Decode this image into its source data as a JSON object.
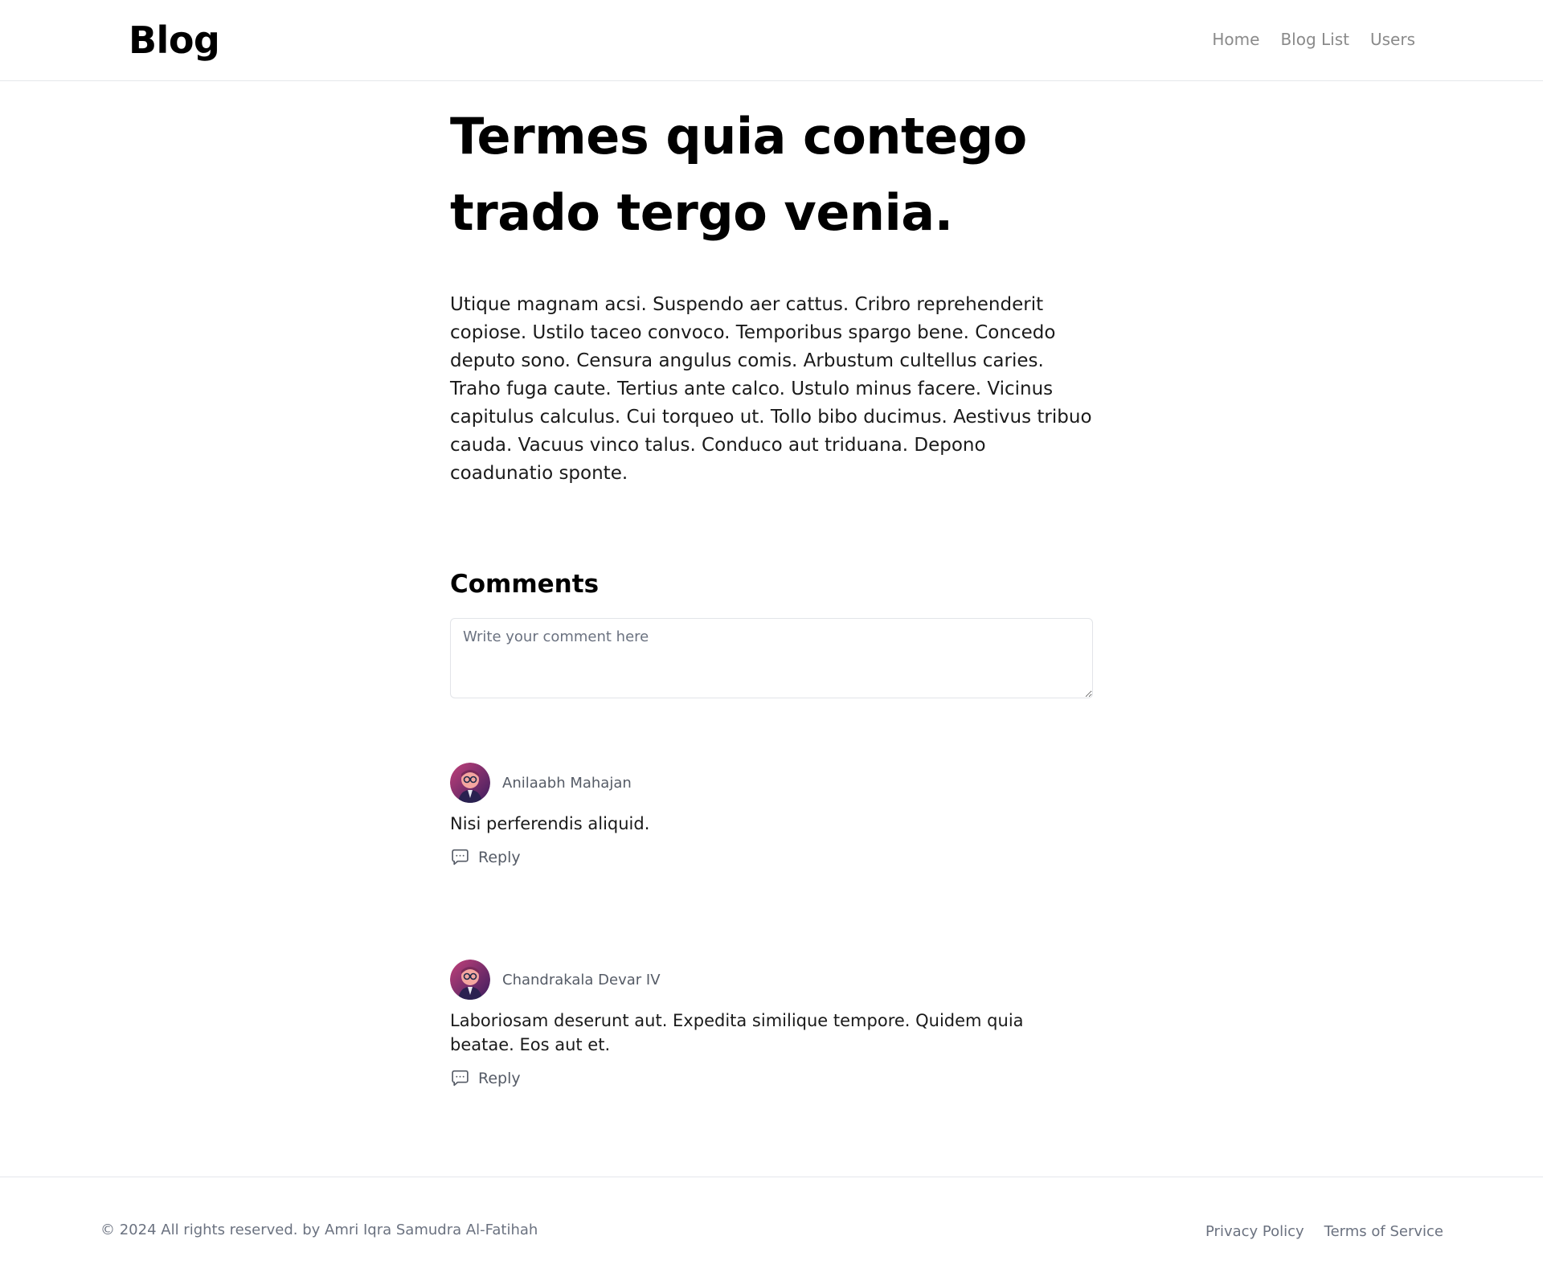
{
  "header": {
    "brand": "Blog",
    "nav": [
      "Home",
      "Blog List",
      "Users"
    ]
  },
  "article": {
    "title": "Termes quia contego trado tergo venia.",
    "body": "Utique magnam acsi. Suspendo aer cattus. Cribro reprehenderit copiose. Ustilo taceo convoco. Temporibus spargo bene. Concedo deputo sono. Censura angulus comis. Arbustum cultellus caries. Traho fuga caute. Tertius ante calco. Ustulo minus facere. Vicinus capitulus calculus. Cui torqueo ut. Tollo bibo ducimus. Aestivus tribuo cauda. Vacuus vinco talus. Conduco aut triduana. Depono coadunatio sponte."
  },
  "comments_section": {
    "title": "Comments",
    "placeholder": "Write your comment here",
    "comments": [
      {
        "author": "Anilaabh Mahajan",
        "text": "Nisi perferendis aliquid.",
        "reply_label": "Reply"
      },
      {
        "author": "Chandrakala Devar IV",
        "text": "Laboriosam deserunt aut. Expedita similique tempore. Quidem quia beatae. Eos aut et.",
        "reply_label": "Reply"
      }
    ]
  },
  "footer": {
    "copyright": "© 2024 All rights reserved. by Amri Iqra Samudra Al-Fatihah",
    "links": [
      "Privacy Policy",
      "Terms of Service"
    ]
  },
  "colors": {
    "accent_text": "#000000",
    "muted_text": "#6b7280",
    "border": "#e5e7eb"
  }
}
